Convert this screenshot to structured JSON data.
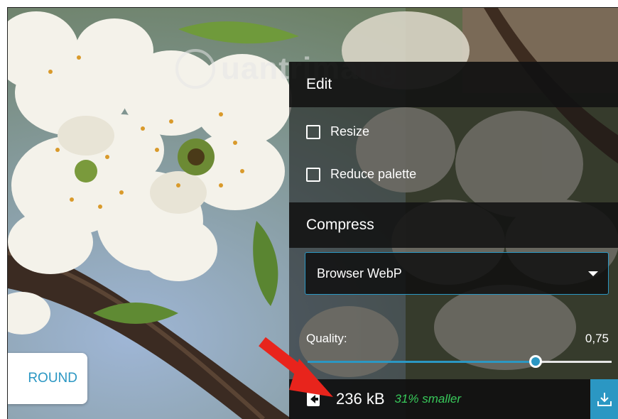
{
  "watermark": {
    "text": "uantrimang"
  },
  "background_button": {
    "label": "ROUND"
  },
  "edit": {
    "title": "Edit",
    "options": [
      {
        "label": "Resize",
        "checked": false
      },
      {
        "label": "Reduce palette",
        "checked": false
      }
    ]
  },
  "compress": {
    "title": "Compress",
    "method": {
      "selected": "Browser WebP"
    },
    "quality": {
      "label": "Quality:",
      "value": "0,75",
      "fraction": 0.75
    }
  },
  "result": {
    "size": "236 kB",
    "savings": "31% smaller"
  },
  "colors": {
    "accent": "#2b97c3",
    "success": "#38c95a",
    "annotation_arrow": "#e8241c"
  },
  "icons": [
    "copy-settings-icon",
    "download-icon",
    "chevron-down-icon",
    "checkbox-icon"
  ]
}
